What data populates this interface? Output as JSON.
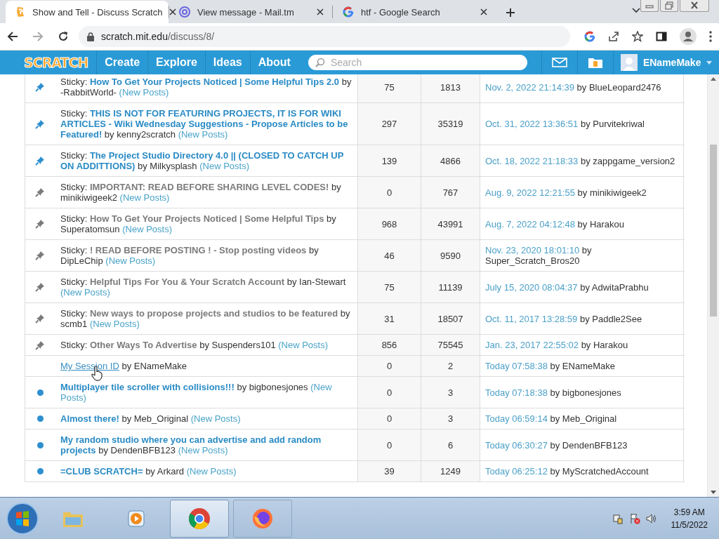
{
  "browser": {
    "tabs": [
      {
        "kind": "scratch",
        "title": "Show and Tell - Discuss Scratch",
        "selected": true
      },
      {
        "kind": "mail",
        "title": "View message - Mail.tm",
        "selected": false
      },
      {
        "kind": "google",
        "title": "htf - Google Search",
        "selected": false
      }
    ],
    "address": {
      "domain": "scratch.mit.edu",
      "path": "/discuss/8/"
    }
  },
  "nav": {
    "logo": "SCRATCH",
    "items": [
      "Create",
      "Explore",
      "Ideas",
      "About"
    ],
    "search_placeholder": "Search",
    "username": "ENameMake"
  },
  "topics": [
    {
      "sticky": true,
      "unread": true,
      "hovered": false,
      "prefix": "Sticky:",
      "title": "How To Get Your Projects Noticed | Some Helpful Tips 2.0",
      "author": "by -RabbitWorld-",
      "new_posts": "(New Posts)",
      "replies": "75",
      "views": "1813",
      "last_time": "Nov. 2, 2022 21:14:39",
      "last_by": "by BlueLeopard2476"
    },
    {
      "sticky": true,
      "unread": true,
      "hovered": false,
      "prefix": "Sticky:",
      "title": "THIS IS NOT FOR FEATURING PROJECTS, IT IS FOR WIKI ARTICLES - Wiki Wednesday Suggestions - Propose Articles to be Featured!",
      "author": "by kenny2scratch",
      "new_posts": "(New Posts)",
      "replies": "297",
      "views": "35319",
      "last_time": "Oct. 31, 2022 13:36:51",
      "last_by": "by Purvitekriwal"
    },
    {
      "sticky": true,
      "unread": true,
      "hovered": false,
      "prefix": "Sticky:",
      "title": "The Project Studio Directory 4.0 || (CLOSED TO CATCH UP ON ADDITTIONS)",
      "author": "by Milkysplash",
      "new_posts": "(New Posts)",
      "replies": "139",
      "views": "4866",
      "last_time": "Oct. 18, 2022 21:18:33",
      "last_by": "by zappgame_version2"
    },
    {
      "sticky": true,
      "unread": false,
      "hovered": false,
      "prefix": "Sticky:",
      "title": "IMPORTANT: READ BEFORE SHARING LEVEL CODES!",
      "author": "by minikiwigeek2",
      "new_posts": "(New Posts)",
      "replies": "0",
      "views": "767",
      "last_time": "Aug. 9, 2022 12:21:55",
      "last_by": "by minikiwigeek2"
    },
    {
      "sticky": true,
      "unread": false,
      "hovered": false,
      "prefix": "Sticky:",
      "title": "How To Get Your Projects Noticed | Some Helpful Tips",
      "author": "by Superatomsun",
      "new_posts": "(New Posts)",
      "replies": "968",
      "views": "43991",
      "last_time": "Aug. 7, 2022 04:12:48",
      "last_by": "by Harakou"
    },
    {
      "sticky": true,
      "unread": false,
      "hovered": false,
      "prefix": "Sticky:",
      "title": "! READ BEFORE POSTING ! - Stop posting videos",
      "author": "by DipLeChip",
      "new_posts": "(New Posts)",
      "replies": "46",
      "views": "9590",
      "last_time": "Nov. 23, 2020 18:01:10",
      "last_by": "by Super_Scratch_Bros20"
    },
    {
      "sticky": true,
      "unread": false,
      "hovered": false,
      "prefix": "Sticky:",
      "title": "Helpful Tips For You & Your Scratch Account",
      "author": "by Ian-Stewart",
      "new_posts": "(New Posts)",
      "replies": "75",
      "views": "11139",
      "last_time": "July 15, 2020 08:04:37",
      "last_by": "by AdwitaPrabhu"
    },
    {
      "sticky": true,
      "unread": false,
      "hovered": false,
      "prefix": "Sticky:",
      "title": "New ways to propose projects and studios to be featured",
      "author": "by scmb1",
      "new_posts": "(New Posts)",
      "replies": "31",
      "views": "18507",
      "last_time": "Oct. 11, 2017 13:28:59",
      "last_by": "by Paddle2See"
    },
    {
      "sticky": true,
      "unread": false,
      "hovered": false,
      "prefix": "Sticky:",
      "title": "Other Ways To Advertise",
      "author": "by Suspenders101",
      "new_posts": "(New Posts)",
      "replies": "856",
      "views": "75545",
      "last_time": "Jan. 23, 2017 22:55:02",
      "last_by": "by Harakou"
    },
    {
      "sticky": false,
      "unread": false,
      "hovered": true,
      "title": "My Session ID",
      "author": "by ENameMake",
      "replies": "0",
      "views": "2",
      "last_time": "Today 07:58:38",
      "last_by": "by ENameMake"
    },
    {
      "sticky": false,
      "unread": true,
      "hovered": false,
      "title": "Multiplayer tile scroller with collisions!!!",
      "author": "by bigbonesjones",
      "new_posts": "(New Posts)",
      "replies": "0",
      "views": "3",
      "last_time": "Today 07:18:38",
      "last_by": "by bigbonesjones"
    },
    {
      "sticky": false,
      "unread": true,
      "hovered": false,
      "title": "Almost there!",
      "author": "by Meb_Original",
      "new_posts": "(New Posts)",
      "replies": "0",
      "views": "3",
      "last_time": "Today 06:59:14",
      "last_by": "by Meb_Original"
    },
    {
      "sticky": false,
      "unread": true,
      "hovered": false,
      "title": "My random studio where you can advertise and add random projects",
      "author": "by DendenBFB123",
      "new_posts": "(New Posts)",
      "replies": "0",
      "views": "6",
      "last_time": "Today 06:30:27",
      "last_by": "by DendenBFB123"
    },
    {
      "sticky": false,
      "unread": true,
      "hovered": false,
      "title": "=CLUB SCRATCH=",
      "author": "by Arkard",
      "new_posts": "(New Posts)",
      "replies": "39",
      "views": "1249",
      "last_time": "Today 06:25:12",
      "last_by": "by MyScratchedAccount"
    }
  ],
  "taskbar": {
    "apps": [
      {
        "kind": "explorer",
        "selected": false
      },
      {
        "kind": "media",
        "selected": false
      },
      {
        "kind": "chrome",
        "selected": true
      },
      {
        "kind": "firefox",
        "selected": false
      }
    ],
    "time": "3:59 AM",
    "date": "11/5/2022"
  }
}
